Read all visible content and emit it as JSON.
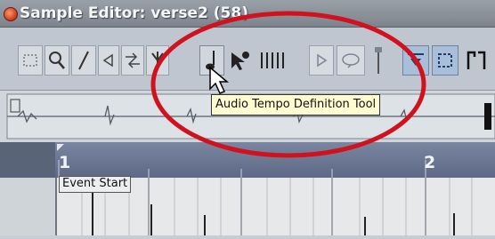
{
  "window": {
    "title": "Sample Editor: verse2 (58)"
  },
  "toolbar": {
    "tools": [
      {
        "name": "range-selection-tool-icon"
      },
      {
        "name": "zoom-tool-icon"
      },
      {
        "name": "draw-tool-icon"
      },
      {
        "name": "play-tool-icon"
      },
      {
        "name": "scrub-tool-icon"
      },
      {
        "name": "hitpoint-tool-icon"
      },
      {
        "name": "audio-tempo-definition-tool-icon"
      },
      {
        "name": "select-hitpoint-tool-icon"
      },
      {
        "name": "grid-icon"
      },
      {
        "name": "play-button-icon"
      },
      {
        "name": "loop-button-icon"
      },
      {
        "name": "pin-icon"
      },
      {
        "name": "snap-icon"
      },
      {
        "name": "autoscroll-icon"
      },
      {
        "name": "bracket-icon"
      }
    ]
  },
  "tooltip": {
    "text": "Audio Tempo Definition Tool"
  },
  "ruler": {
    "bar1": "1",
    "bar2": "2"
  },
  "event": {
    "label": "Event Start"
  },
  "colors": {
    "highlight_oval": "#d0121f",
    "ruler_bg": "#6b7692"
  }
}
